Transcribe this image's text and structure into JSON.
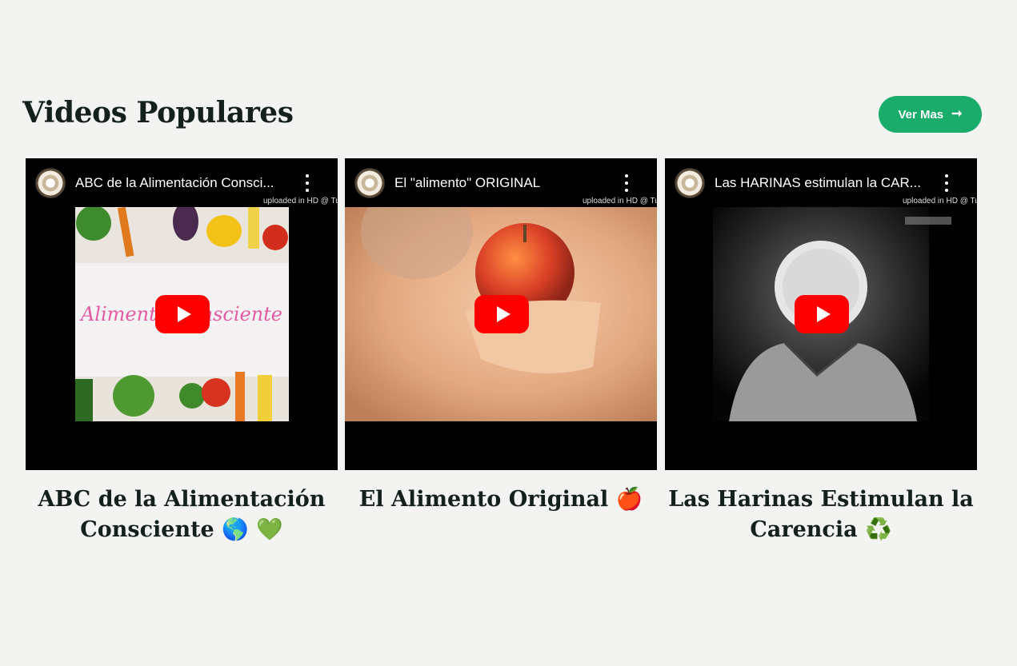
{
  "section": {
    "title": "Videos Populares",
    "ver_mas": {
      "label": "Ver Mas",
      "icon": "arrow-right-icon"
    }
  },
  "videos": [
    {
      "player_title": "ABC de la Alimentación Consci...",
      "uploaded_note": "uploaded in HD @ Tun",
      "thumbnail_text": "Alimento Consciente",
      "caption": "ABC de la Alimentación Consciente 🌎 💚"
    },
    {
      "player_title": "El \"alimento\" ORIGINAL",
      "uploaded_note": "uploaded in HD @ Tun",
      "thumbnail_text": "",
      "caption": "El Alimento Original 🍎"
    },
    {
      "player_title": "Las HARINAS estimulan la CAR...",
      "uploaded_note": "uploaded in HD @ Tun",
      "thumbnail_text": "",
      "caption": "Las Harinas Estimulan la Carencia ♻️"
    }
  ],
  "colors": {
    "background": "#f3f4f2",
    "accent": "#1aac6b",
    "heading": "#13201d",
    "youtube_red": "#ff0000"
  }
}
